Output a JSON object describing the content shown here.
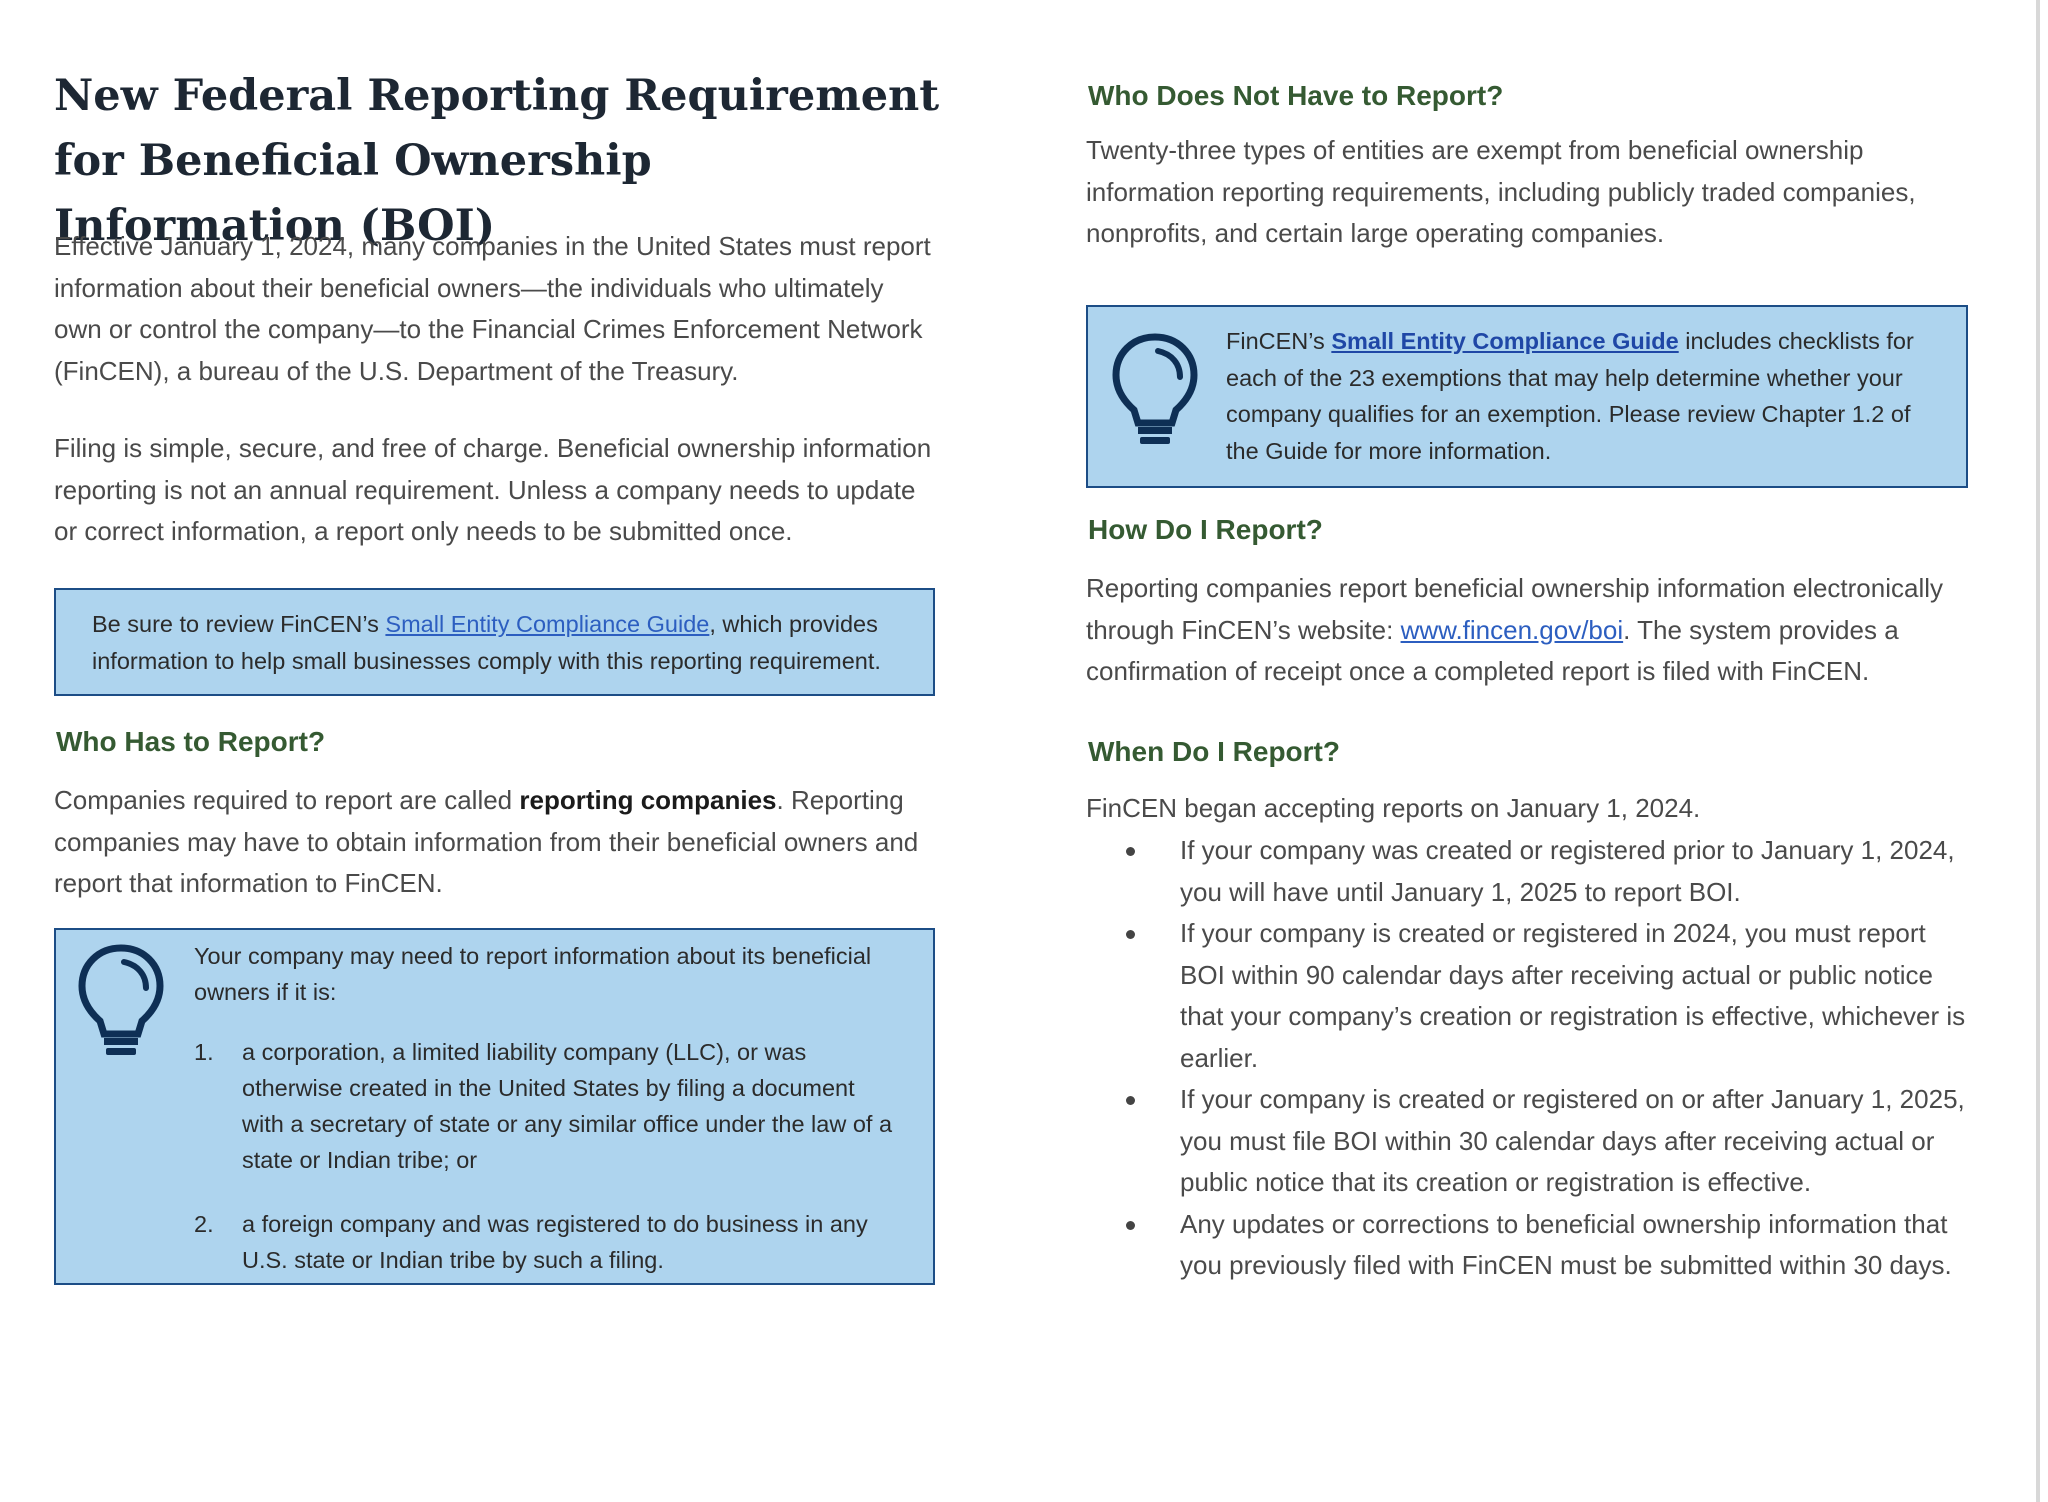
{
  "title": "New Federal Reporting Requirement for Beneficial Ownership Information (BOI)",
  "intro_paragraph": "Effective January 1, 2024, many companies in the United States must report information about their beneficial owners—the individuals who ultimately own or control the company—to the Financial Crimes Enforcement Network (FinCEN), a bureau of the U.S. Department of the Treasury.",
  "filing_paragraph": "Filing is simple, secure, and free of charge. Beneficial ownership information reporting is not an annual requirement. Unless a company needs to update or correct information, a report only needs to be submitted once.",
  "review_box": {
    "text_before": "Be sure to review FinCEN’s ",
    "link_text": "Small Entity Compliance Guide",
    "text_after": ", which provides information to help small businesses comply with this reporting requirement."
  },
  "who_has": {
    "heading": "Who Has to Report?",
    "text_before": "Companies required to report are called ",
    "bold_text": "reporting companies",
    "text_after": ". Reporting companies may have to obtain information from their beneficial owners and report that information to FinCEN."
  },
  "company_box": {
    "icon": "lightbulb-icon",
    "intro": "Your company may need to report information about its beneficial owners if it is:",
    "items": [
      {
        "num": "1.",
        "text": "a corporation, a limited liability company (LLC), or was otherwise created in the United States by filing a document with a secretary of state or any similar office under the law of a state or Indian tribe; or"
      },
      {
        "num": "2.",
        "text": "a foreign company and was registered to do business in any U.S. state or Indian tribe by such a filing."
      }
    ]
  },
  "who_not": {
    "heading": "Who Does Not Have to Report?",
    "text": "Twenty-three types of entities are exempt from beneficial ownership information reporting requirements, including publicly traded companies, nonprofits, and certain large operating companies."
  },
  "exempt_box": {
    "icon": "lightbulb-icon",
    "text_before": "FinCEN’s ",
    "link_text": "Small Entity Compliance Guide",
    "text_after": " includes checklists for each of the 23 exemptions that may help determine whether your company qualifies for an exemption. Please review Chapter 1.2 of the Guide for more information."
  },
  "how": {
    "heading": "How Do I Report?",
    "text_before": "Reporting companies report beneficial ownership information electronically through FinCEN’s website: ",
    "link_text": "www.fincen.gov/boi",
    "text_after": ". The system provides a confirmation of receipt once a completed report is filed with FinCEN."
  },
  "when": {
    "heading": "When Do I Report?",
    "intro": "FinCEN began accepting reports on January 1, 2024.",
    "bullets": [
      "If your company was created or registered prior to January 1, 2024, you will have until January 1, 2025 to report BOI.",
      "If your company is created or registered in 2024, you must report BOI within 90 calendar days after receiving actual or public notice that your company’s creation or registration is effective, whichever is earlier.",
      "If your company is created or registered on or after January 1, 2025, you must file BOI within 30 calendar days after receiving actual or public notice that its creation or registration is effective.",
      "Any updates or corrections to beneficial ownership information that you previously filed with FinCEN must be submitted within 30 days."
    ]
  },
  "colors": {
    "heading_green": "#355a32",
    "box_fill": "#aed4ee",
    "box_border": "#1c4d86",
    "link_blue": "#2c5ec0"
  }
}
